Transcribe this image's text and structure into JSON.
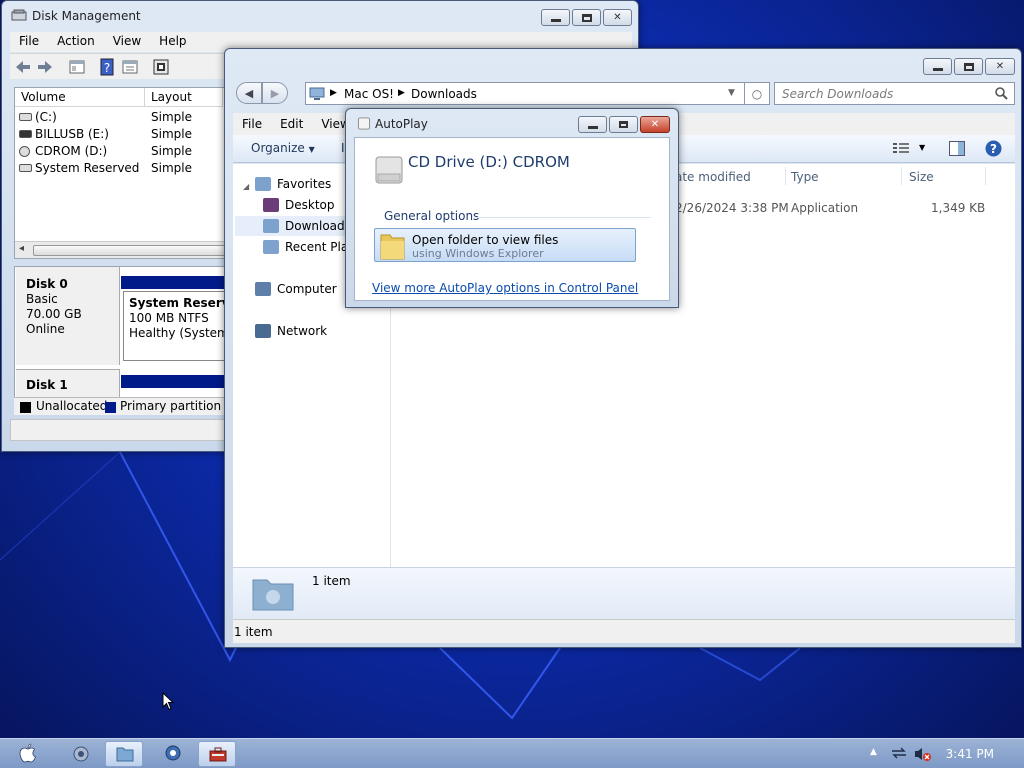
{
  "disk_management": {
    "title": "Disk Management",
    "menu": [
      "File",
      "Action",
      "View",
      "Help"
    ],
    "columns": [
      "Volume",
      "Layout"
    ],
    "volumes": [
      {
        "name": "(C:)",
        "layout": "Simple"
      },
      {
        "name": "BILLUSB (E:)",
        "layout": "Simple"
      },
      {
        "name": "CDROM (D:)",
        "layout": "Simple"
      },
      {
        "name": "System Reserved",
        "layout": "Simple"
      }
    ],
    "disk0": {
      "name": "Disk 0",
      "type": "Basic",
      "size": "70.00 GB",
      "status": "Online"
    },
    "partition": {
      "name": "System Reserved",
      "size": "100 MB NTFS",
      "health": "Healthy (System, A"
    },
    "disk1": {
      "name": "Disk 1"
    },
    "legend": [
      "Unallocated",
      "Primary partition"
    ],
    "colors": {
      "unallocated": "#000000",
      "primary": "#001a8a"
    }
  },
  "explorer": {
    "breadcrumb": [
      "Mac OS!",
      "Downloads"
    ],
    "search_placeholder": "Search Downloads",
    "menu": [
      "File",
      "Edit",
      "View"
    ],
    "organize_label": "Organize",
    "tools_stub": "I",
    "nav": {
      "favorites": "Favorites",
      "desktop": "Desktop",
      "downloads": "Downloads",
      "recent": "Recent Plac",
      "computer": "Computer",
      "network": "Network"
    },
    "columns": [
      "ate modified",
      "Type",
      "Size"
    ],
    "file": {
      "date": "2/26/2024 3:38 PM",
      "type": "Application",
      "size": "1,349 KB"
    },
    "detail_count": "1 item",
    "status_count": "1 item"
  },
  "autoplay": {
    "title": "AutoPlay",
    "device": "CD Drive (D:) CDROM",
    "section": "General options",
    "option_title": "Open folder to view files",
    "option_sub": "using Windows Explorer",
    "link": "View more AutoPlay options in Control Panel"
  },
  "taskbar": {
    "clock": "3:41 PM"
  }
}
